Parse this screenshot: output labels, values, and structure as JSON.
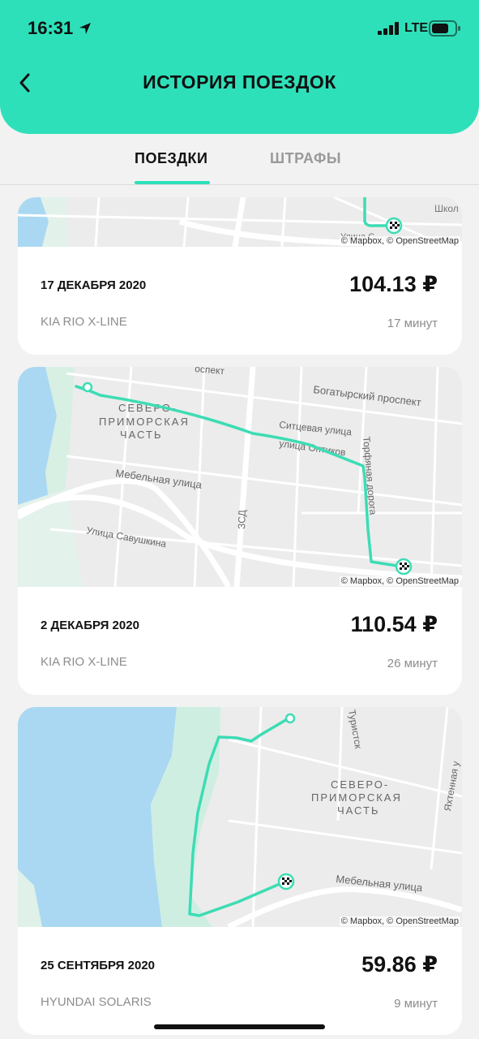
{
  "status_bar": {
    "time": "16:31",
    "network": "LTE"
  },
  "header": {
    "title": "ИСТОРИЯ ПОЕЗДОК"
  },
  "tabs": [
    {
      "label": "ПОЕЗДКИ"
    },
    {
      "label": "ШТРАФЫ"
    }
  ],
  "colors": {
    "accent": "#2ee0b9",
    "water": "#aad8f2",
    "park": "#cfeee2",
    "route": "#3ddcb4"
  },
  "trips": [
    {
      "date": "17 ДЕКАБРЯ 2020",
      "price": "104.13 ₽",
      "car": "KIA RIO X-LINE",
      "duration": "17 минут",
      "map": {
        "attribution": "© Mapbox, © OpenStreetMap",
        "labels": [
          "Школ",
          "Улица С"
        ]
      }
    },
    {
      "date": "2 ДЕКАБРЯ 2020",
      "price": "110.54 ₽",
      "car": "KIA RIO X-LINE",
      "duration": "26 минут",
      "map": {
        "attribution": "© Mapbox, © OpenStreetMap",
        "labels": [
          "оспект",
          "Богатырский проспект",
          "СЕВЕРО-",
          "ПРИМОРСКАЯ",
          "ЧАСТЬ",
          "Ситцевая улица",
          "улица Оптиков",
          "Торфяная дорога",
          "Мебельная улица",
          "ЗСД",
          "Улица Савушкина"
        ]
      }
    },
    {
      "date": "25 СЕНТЯБРЯ 2020",
      "price": "59.86 ₽",
      "car": "HYUNDAI SOLARIS",
      "duration": "9 минут",
      "map": {
        "attribution": "© Mapbox, © OpenStreetMap",
        "labels": [
          "Туристск",
          "Яхтенная у",
          "СЕВЕРО-",
          "ПРИМОРСКАЯ",
          "ЧАСТЬ",
          "Мебельная улица"
        ]
      }
    }
  ]
}
